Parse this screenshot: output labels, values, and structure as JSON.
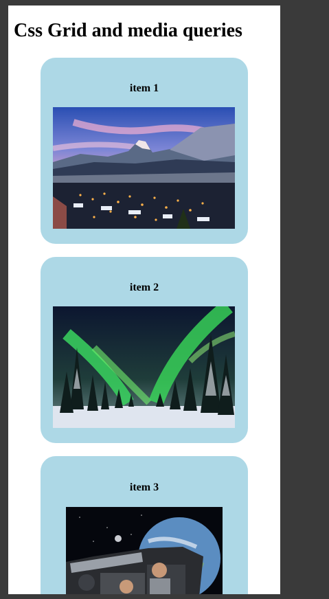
{
  "page": {
    "title": "Css Grid and media queries"
  },
  "cards": [
    {
      "label": "item 1",
      "image": "snowy-mountain-village-at-dusk"
    },
    {
      "label": "item 2",
      "image": "northern-lights-over-snowy-forest"
    },
    {
      "label": "item 3",
      "image": "two-men-in-car-with-earth-in-space"
    }
  ],
  "colors": {
    "card_bg": "#add8e6",
    "page_bg": "#ffffff",
    "outer_bg": "#3a3a3a"
  }
}
